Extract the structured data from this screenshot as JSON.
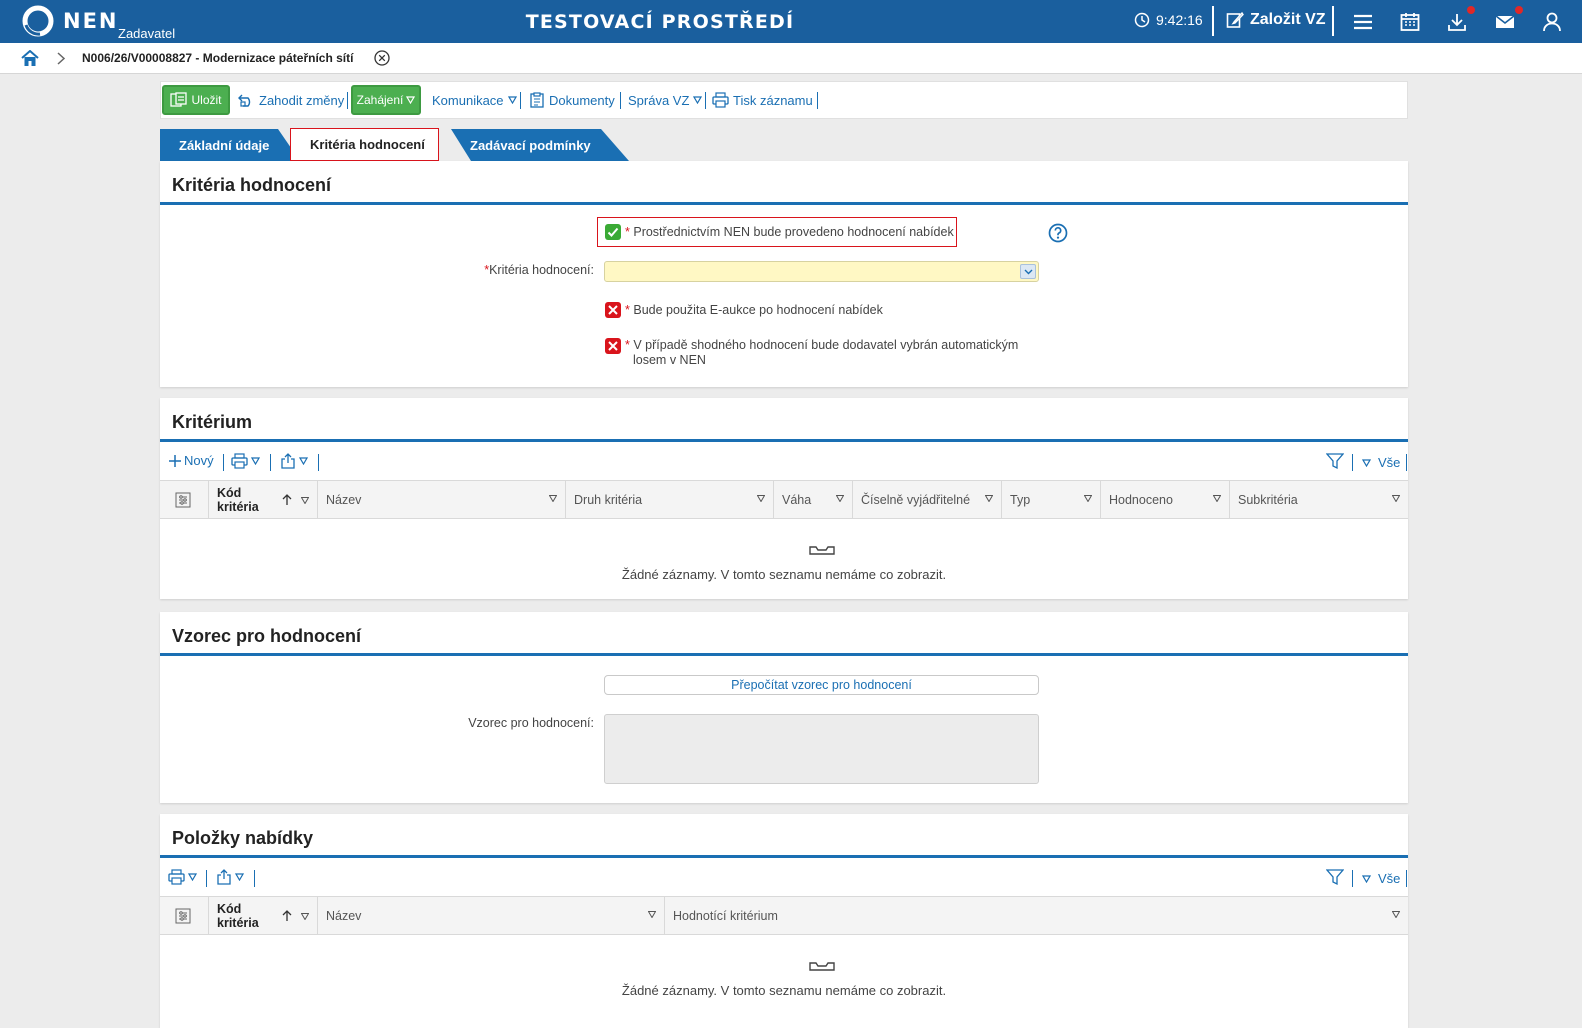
{
  "header": {
    "brand": "NEN",
    "role": "Zadavatel",
    "environment": "TESTOVACÍ PROSTŘEDÍ",
    "clock": "9:42:16",
    "new_vz": "Založit VZ",
    "icons": [
      "menu-icon",
      "calendar-icon",
      "download-icon",
      "mail-icon",
      "user-icon"
    ],
    "brand_color": "#1a5f9e",
    "notification_color": "#e02828"
  },
  "breadcrumb": {
    "title": "N006/26/V00008827 - Modernizace páteřních sítí"
  },
  "toolbar": {
    "save": "Uložit",
    "discard": "Zahodit změny",
    "start": "Zahájení",
    "communication": "Komunikace",
    "documents": "Dokumenty",
    "management": "Správa VZ",
    "print": "Tisk záznamu"
  },
  "tabs": [
    {
      "label": "Základní údaje"
    },
    {
      "label": "Kritéria hodnocení"
    },
    {
      "label": "Zadávací podmínky"
    }
  ],
  "criteria_section": {
    "title": "Kritéria hodnocení",
    "nen_evaluation": {
      "label": "Prostřednictvím NEN bude provedeno hodnocení nabídek",
      "checked": true
    },
    "criteria_field": {
      "label": "Kritéria hodnocení:",
      "value": ""
    },
    "eauction": {
      "label": "Bude použita E-aukce po hodnocení nabídek",
      "checked": false
    },
    "lottery": {
      "label": "V případě shodného hodnocení bude dodavatel vybrán automatickým losem v NEN",
      "checked": false
    }
  },
  "criterion_section": {
    "title": "Kritérium",
    "new_label": "Nový",
    "filter_all": "Vše",
    "columns": [
      "Kód kritéria",
      "Název",
      "Druh kritéria",
      "Váha",
      "Číselně vyjádřitelné",
      "Typ",
      "Hodnoceno",
      "Subkritéria"
    ],
    "empty": "Žádné záznamy. V tomto seznamu nemáme co zobrazit."
  },
  "formula_section": {
    "title": "Vzorec pro hodnocení",
    "recalc": "Přepočítat vzorec pro hodnocení",
    "field_label": "Vzorec pro hodnocení:",
    "value": ""
  },
  "items_section": {
    "title": "Položky nabídky",
    "filter_all": "Vše",
    "columns": [
      "Kód kritéria",
      "Název",
      "Hodnotící kritérium"
    ],
    "empty": "Žádné záznamy. V tomto seznamu nemáme co zobrazit."
  }
}
